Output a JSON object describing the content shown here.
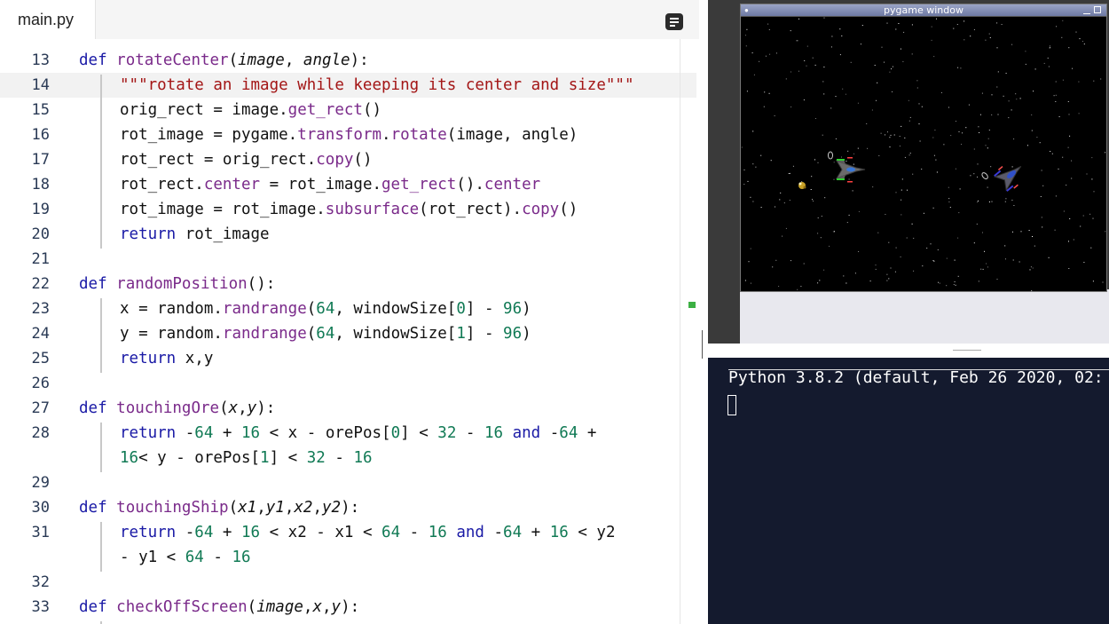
{
  "editor": {
    "tab_label": "main.py",
    "highlight_line": 14,
    "lines": [
      {
        "n": "13"
      },
      {
        "n": "14"
      },
      {
        "n": "15"
      },
      {
        "n": "16"
      },
      {
        "n": "17"
      },
      {
        "n": "18"
      },
      {
        "n": "19"
      },
      {
        "n": "20"
      },
      {
        "n": "21"
      },
      {
        "n": "22"
      },
      {
        "n": "23"
      },
      {
        "n": "24"
      },
      {
        "n": "25"
      },
      {
        "n": "26"
      },
      {
        "n": "27"
      },
      {
        "n": "28"
      },
      {
        "n": ""
      },
      {
        "n": "29"
      },
      {
        "n": "30"
      },
      {
        "n": "31"
      },
      {
        "n": ""
      },
      {
        "n": "32"
      },
      {
        "n": "33"
      }
    ],
    "code": {
      "l13": [
        "def ",
        "rotateCenter",
        "(",
        "image",
        ", ",
        "angle",
        "):"
      ],
      "l14": "\"\"\"rotate an image while keeping its center and size\"\"\"",
      "l15": [
        "orig_rect = image.",
        "get_rect",
        "()"
      ],
      "l16": [
        "rot_image = pygame.",
        "transform",
        ".",
        "rotate",
        "(image, angle)"
      ],
      "l17": [
        "rot_rect = orig_rect.",
        "copy",
        "()"
      ],
      "l18": [
        "rot_rect.",
        "center",
        " = rot_image.",
        "get_rect",
        "().",
        "center"
      ],
      "l19": [
        "rot_image = rot_image.",
        "subsurface",
        "(rot_rect).",
        "copy",
        "()"
      ],
      "l20": [
        "return",
        " rot_image"
      ],
      "l22": [
        "def ",
        "randomPosition",
        "():"
      ],
      "l23": [
        "x = random.",
        "randrange",
        "(",
        "64",
        ", windowSize[",
        "0",
        "] - ",
        "96",
        ")"
      ],
      "l24": [
        "y = random.",
        "randrange",
        "(",
        "64",
        ", windowSize[",
        "1",
        "] - ",
        "96",
        ")"
      ],
      "l25": [
        "return",
        " x,y"
      ],
      "l27": [
        "def ",
        "touchingOre",
        "(",
        "x",
        ",",
        "y",
        "):"
      ],
      "l28a": [
        "return",
        " -",
        "64",
        " + ",
        "16",
        " < x - orePos[",
        "0",
        "] < ",
        "32",
        " - ",
        "16",
        " ",
        "and",
        " -",
        "64",
        " +"
      ],
      "l28b": [
        "16",
        "< y - orePos[",
        "1",
        "] < ",
        "32",
        " - ",
        "16"
      ],
      "l30": [
        "def ",
        "touchingShip",
        "(",
        "x1",
        ",",
        "y1",
        ",",
        "x2",
        ",",
        "y2",
        "):"
      ],
      "l31a": [
        "return",
        " -",
        "64",
        " + ",
        "16",
        " < x2 - x1 < ",
        "64",
        " - ",
        "16",
        " ",
        "and",
        " -",
        "64",
        " + ",
        "16",
        " < y2"
      ],
      "l31b": [
        "- y1 < ",
        "64",
        " - ",
        "16"
      ],
      "l33": [
        "def ",
        "checkOffScreen",
        "(",
        "image",
        ",",
        "x",
        ",",
        "y",
        "):"
      ]
    }
  },
  "pygame": {
    "title": "pygame window",
    "background": "#000000"
  },
  "console": {
    "banner": "Python 3.8.2 (default, Feb 26 2020, 02:",
    "background": "#141a2e"
  },
  "colors": {
    "keyword": "#1a1aa6",
    "function": "#7a2a8a",
    "string": "#a31515",
    "number": "#117a55"
  }
}
